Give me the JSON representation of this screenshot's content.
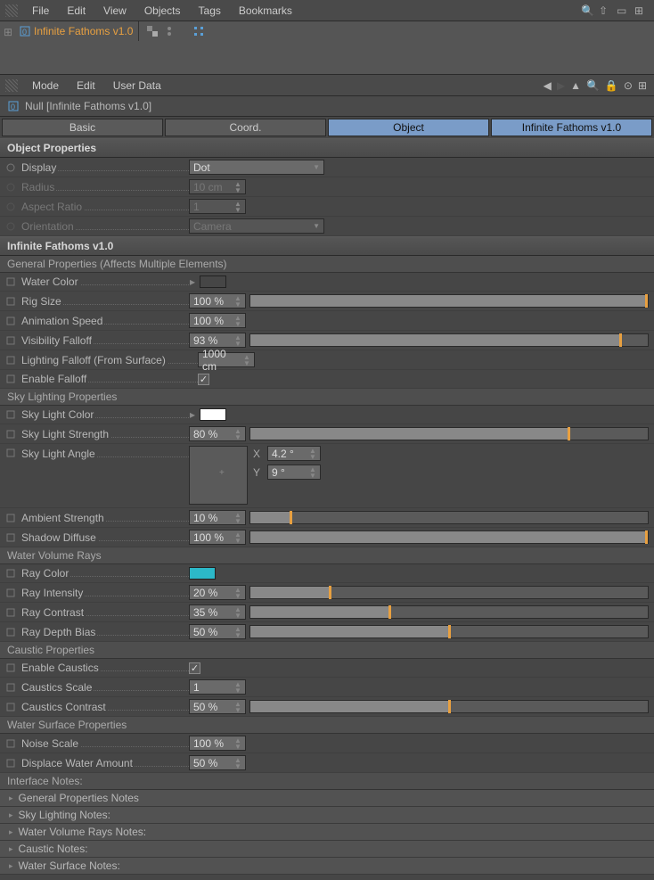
{
  "menubar": {
    "items": [
      "File",
      "Edit",
      "View",
      "Objects",
      "Tags",
      "Bookmarks"
    ]
  },
  "tabstrip": {
    "active_tab_label": "Infinite Fathoms v1.0"
  },
  "submenu": {
    "items": [
      "Mode",
      "Edit",
      "User Data"
    ]
  },
  "object_header": {
    "type": "Null",
    "name": "[Infinite Fathoms v1.0]"
  },
  "attr_tabs": {
    "basic": "Basic",
    "coord": "Coord.",
    "object": "Object",
    "plugin": "Infinite Fathoms v1.0"
  },
  "sections": {
    "object_props": {
      "title": "Object Properties",
      "display_label": "Display",
      "display_value": "Dot",
      "radius_label": "Radius",
      "radius_value": "10 cm",
      "aspect_label": "Aspect Ratio",
      "aspect_value": "1",
      "orient_label": "Orientation",
      "orient_value": "Camera"
    },
    "plugin_title": "Infinite Fathoms v1.0",
    "general": {
      "header": "General Properties  (Affects Multiple Elements)",
      "water_color_label": "Water Color",
      "water_color": "#0a3fcf",
      "rig_size_label": "Rig Size",
      "rig_size": "100 %",
      "rig_size_pct": 100,
      "anim_speed_label": "Animation Speed",
      "anim_speed": "100 %",
      "vis_falloff_label": "Visibility Falloff",
      "vis_falloff": "93 %",
      "vis_falloff_pct": 93,
      "light_falloff_label": "Lighting Falloff (From Surface)",
      "light_falloff": "1000 cm",
      "enable_falloff_label": "Enable Falloff",
      "enable_falloff": true
    },
    "sky": {
      "header": "Sky Lighting Properties",
      "color_label": "Sky Light Color",
      "color": "#ffffff",
      "strength_label": "Sky Light Strength",
      "strength": "80 %",
      "strength_pct": 80,
      "angle_label": "Sky Light Angle",
      "angle_x_label": "X",
      "angle_x": "4.2 °",
      "angle_y_label": "Y",
      "angle_y": "9 °",
      "ambient_label": "Ambient Strength",
      "ambient": "10 %",
      "ambient_pct": 10,
      "shadow_label": "Shadow Diffuse",
      "shadow": "100 %",
      "shadow_pct": 100
    },
    "rays": {
      "header": "Water Volume Rays",
      "color_label": "Ray Color",
      "color": "#2cb8c8",
      "intensity_label": "Ray Intensity",
      "intensity": "20 %",
      "intensity_pct": 20,
      "contrast_label": "Ray Contrast",
      "contrast": "35 %",
      "contrast_pct": 35,
      "depth_label": "Ray Depth Bias",
      "depth": "50 %",
      "depth_pct": 50
    },
    "caustic": {
      "header": "Caustic Properties",
      "enable_label": "Enable Caustics",
      "enable": true,
      "scale_label": "Caustics Scale",
      "scale": "1",
      "contrast_label": "Caustics Contrast",
      "contrast": "50 %",
      "contrast_pct": 50
    },
    "surface": {
      "header": "Water Surface Properties",
      "noise_label": "Noise Scale",
      "noise": "100 %",
      "displace_label": "Displace Water Amount",
      "displace": "50 %"
    },
    "notes": {
      "header": "Interface Notes:",
      "items": [
        "General Properties Notes",
        "Sky Lighting Notes:",
        "Water Volume Rays Notes:",
        "Caustic Notes:",
        "Water Surface Notes:"
      ]
    }
  }
}
